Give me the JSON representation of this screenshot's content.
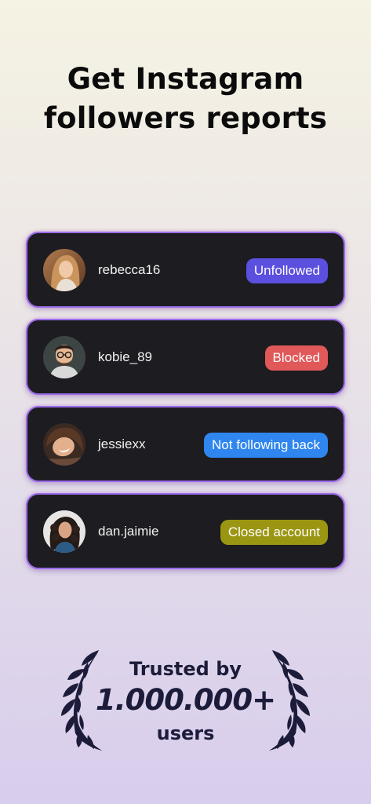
{
  "headline": {
    "line1": "Get Instagram",
    "line2": "followers reports"
  },
  "reports": [
    {
      "username": "rebecca16",
      "status": "Unfollowed",
      "status_color": "#5b4fe0",
      "avatar": "woman-blonde-avatar"
    },
    {
      "username": "kobie_89",
      "status": "Blocked",
      "status_color": "#e05858",
      "avatar": "man-glasses-avatar"
    },
    {
      "username": "jessiexx",
      "status": "Not following back",
      "status_color": "#2f86ee",
      "avatar": "woman-smiling-avatar"
    },
    {
      "username": "dan.jaimie",
      "status": "Closed account",
      "status_color": "#9a9612",
      "avatar": "woman-curly-hair-avatar"
    }
  ],
  "trusted": {
    "line1": "Trusted by",
    "count": "1.000.000+",
    "line3": "users"
  },
  "colors": {
    "card_background": "#1d1c20",
    "card_border": "#9a6de8",
    "laurel": "#1c1c3a"
  }
}
